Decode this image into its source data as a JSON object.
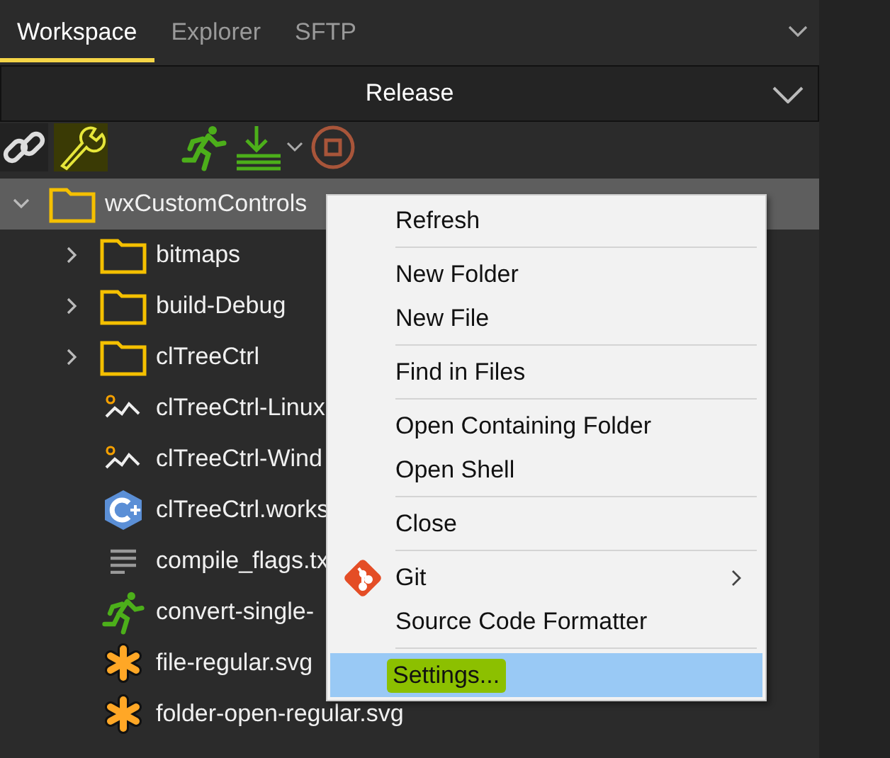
{
  "tabs": [
    {
      "label": "Workspace",
      "selected": true
    },
    {
      "label": "Explorer",
      "selected": false
    },
    {
      "label": "SFTP",
      "selected": false
    }
  ],
  "configuration": {
    "value": "Release"
  },
  "tree": {
    "label": "wxCustomControls",
    "expanded": true,
    "selected": true,
    "children": [
      {
        "label": "bitmaps",
        "kind": "folder",
        "expanded": false
      },
      {
        "label": "build-Debug",
        "kind": "folder",
        "expanded": false
      },
      {
        "label": "clTreeCtrl",
        "kind": "folder",
        "expanded": false
      },
      {
        "label": "clTreeCtrl-Linux",
        "kind": "chart"
      },
      {
        "label": "clTreeCtrl-Wind",
        "kind": "chart"
      },
      {
        "label": "clTreeCtrl.works",
        "kind": "cpp"
      },
      {
        "label": "compile_flags.tx",
        "kind": "text"
      },
      {
        "label": "convert-single-",
        "kind": "script"
      },
      {
        "label": "file-regular.svg",
        "kind": "svg"
      },
      {
        "label": "folder-open-regular.svg",
        "kind": "svg"
      }
    ]
  },
  "context_menu": {
    "groups": [
      [
        {
          "label": "Refresh",
          "selected": false
        }
      ],
      [
        {
          "label": "New Folder",
          "selected": false
        },
        {
          "label": "New File",
          "selected": false
        }
      ],
      [
        {
          "label": "Find in Files",
          "selected": false
        }
      ],
      [
        {
          "label": "Open Containing Folder",
          "selected": false
        },
        {
          "label": "Open Shell",
          "selected": false
        }
      ],
      [
        {
          "label": "Close",
          "selected": false
        }
      ],
      [
        {
          "label": "Git",
          "selected": false,
          "kind": "git",
          "submenu": true
        },
        {
          "label": "Source Code Formatter",
          "selected": false
        }
      ],
      [
        {
          "label": "Settings...",
          "selected": true,
          "highlighted": true
        }
      ]
    ]
  }
}
